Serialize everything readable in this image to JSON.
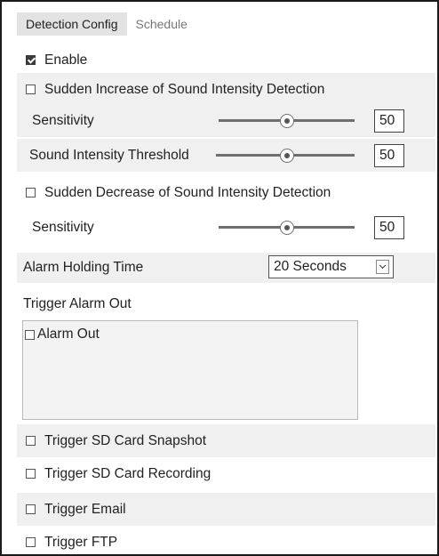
{
  "tabs": [
    "Detection Config",
    "Schedule"
  ],
  "enable": {
    "label": "Enable",
    "checked": true
  },
  "sudden_increase": {
    "label": "Sudden Increase of Sound Intensity Detection",
    "checked": false,
    "sensitivity": {
      "label": "Sensitivity",
      "value": "50"
    },
    "threshold": {
      "label": "Sound Intensity Threshold",
      "value": "50"
    }
  },
  "sudden_decrease": {
    "label": "Sudden Decrease of Sound Intensity Detection",
    "checked": false,
    "sensitivity": {
      "label": "Sensitivity",
      "value": "50"
    }
  },
  "alarm_holding": {
    "label": "Alarm Holding Time",
    "value": "20 Seconds"
  },
  "trigger_alarm_out": {
    "label": "Trigger Alarm Out",
    "items": [
      {
        "label": "Alarm Out",
        "checked": false
      }
    ]
  },
  "triggers": [
    {
      "label": "Trigger SD Card Snapshot",
      "checked": false
    },
    {
      "label": "Trigger SD Card Recording",
      "checked": false
    },
    {
      "label": "Trigger Email",
      "checked": false
    },
    {
      "label": "Trigger FTP",
      "checked": false
    }
  ]
}
